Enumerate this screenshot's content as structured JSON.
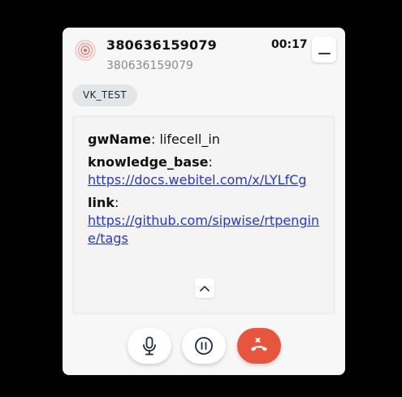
{
  "call": {
    "caller_name": "380636159079",
    "caller_number": "380636159079",
    "timer": "00:17"
  },
  "tag": {
    "label": "VK_TEST"
  },
  "info": {
    "gw_key": "gwName",
    "gw_sep": ": ",
    "gw_value": "lifecell_in",
    "kb_key": "knowledge_base",
    "kb_sep": ":",
    "kb_url": "https://docs.webitel.com/x/LYLfCg",
    "link_key": "link",
    "link_sep": ":",
    "link_url": "https://github.com/sipwise/rtpengine/tags"
  },
  "icons": {
    "avatar": "ringing-waves-icon",
    "minimize": "minimize-icon",
    "collapse": "chevron-up-icon",
    "mic": "microphone-icon",
    "hold": "pause-icon",
    "end": "hangup-icon"
  },
  "colors": {
    "end_call": "#e8553d",
    "link": "#2a37c8",
    "avatar_accent": "#f28b82"
  }
}
